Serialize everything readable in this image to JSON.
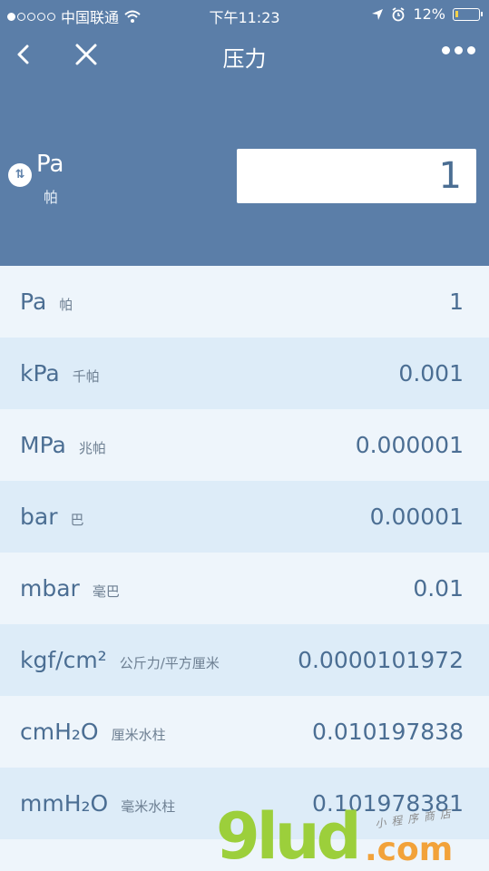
{
  "status": {
    "carrier": "中国联通",
    "time": "下午11:23",
    "battery": "12%",
    "battery_level": 0.12,
    "signal_dots_filled": 1
  },
  "nav": {
    "title": "压力",
    "icons": [
      "back-chevron-icon",
      "close-icon",
      "more-dots-icon"
    ]
  },
  "converter": {
    "swap_icon_glyph": "⇅",
    "selected_unit": "Pa",
    "selected_unit_name": "帕",
    "input_value": "1"
  },
  "rows": [
    {
      "unit": "Pa",
      "name": "帕",
      "value": "1"
    },
    {
      "unit": "kPa",
      "name": "千帕",
      "value": "0.001"
    },
    {
      "unit": "MPa",
      "name": "兆帕",
      "value": "0.000001"
    },
    {
      "unit": "bar",
      "name": "巴",
      "value": "0.00001"
    },
    {
      "unit": "mbar",
      "name": "毫巴",
      "value": "0.01"
    },
    {
      "unit": "kgf/cm²",
      "name": "公斤力/平方厘米",
      "value": "0.0000101972"
    },
    {
      "unit": "cmH₂O",
      "name": "厘米水柱",
      "value": "0.010197838"
    },
    {
      "unit": "mmH₂O",
      "name": "毫米水柱",
      "value": "0.101978381"
    }
  ],
  "watermark": {
    "brand": "9lud",
    "suffix": ".com",
    "tagline": "小程序商店"
  },
  "colors": {
    "header_bg": "#5b7ea8",
    "row_light": "#eef5fb",
    "row_dark": "#ddecf8",
    "text_primary": "#4b6e93",
    "battery_fill": "#f2d14a"
  }
}
